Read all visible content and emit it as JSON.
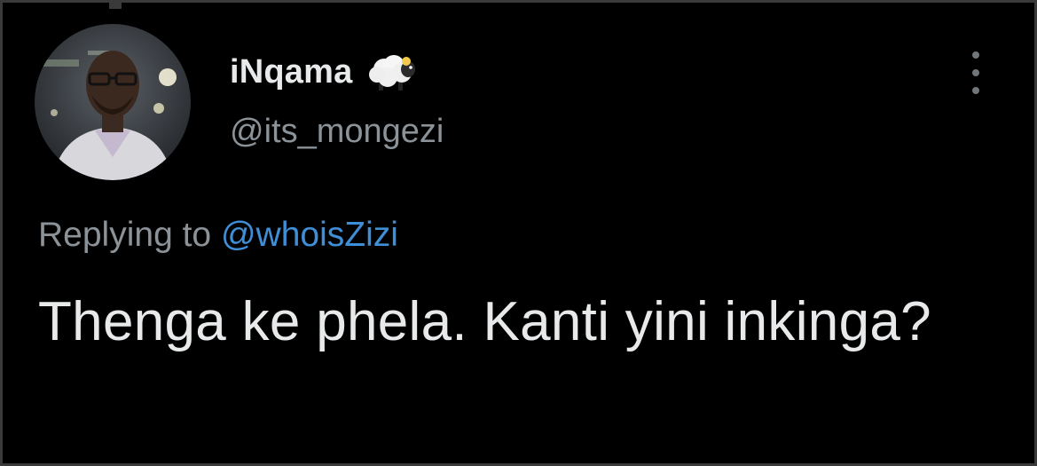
{
  "author": {
    "display_name": "iNqama",
    "badge_icon": "sheep-icon",
    "handle": "@its_mongezi",
    "avatar": "profile-photo"
  },
  "reply": {
    "prefix": "Replying to",
    "mention": "@whoisZizi"
  },
  "tweet": {
    "text": "Thenga ke phela. Kanti yini inkinga?"
  },
  "menu": {
    "icon": "more-vertical-icon"
  },
  "colors": {
    "background": "#000000",
    "primary_text": "#e7e9ea",
    "secondary_text": "#8b9298",
    "link": "#3f8fd8"
  }
}
